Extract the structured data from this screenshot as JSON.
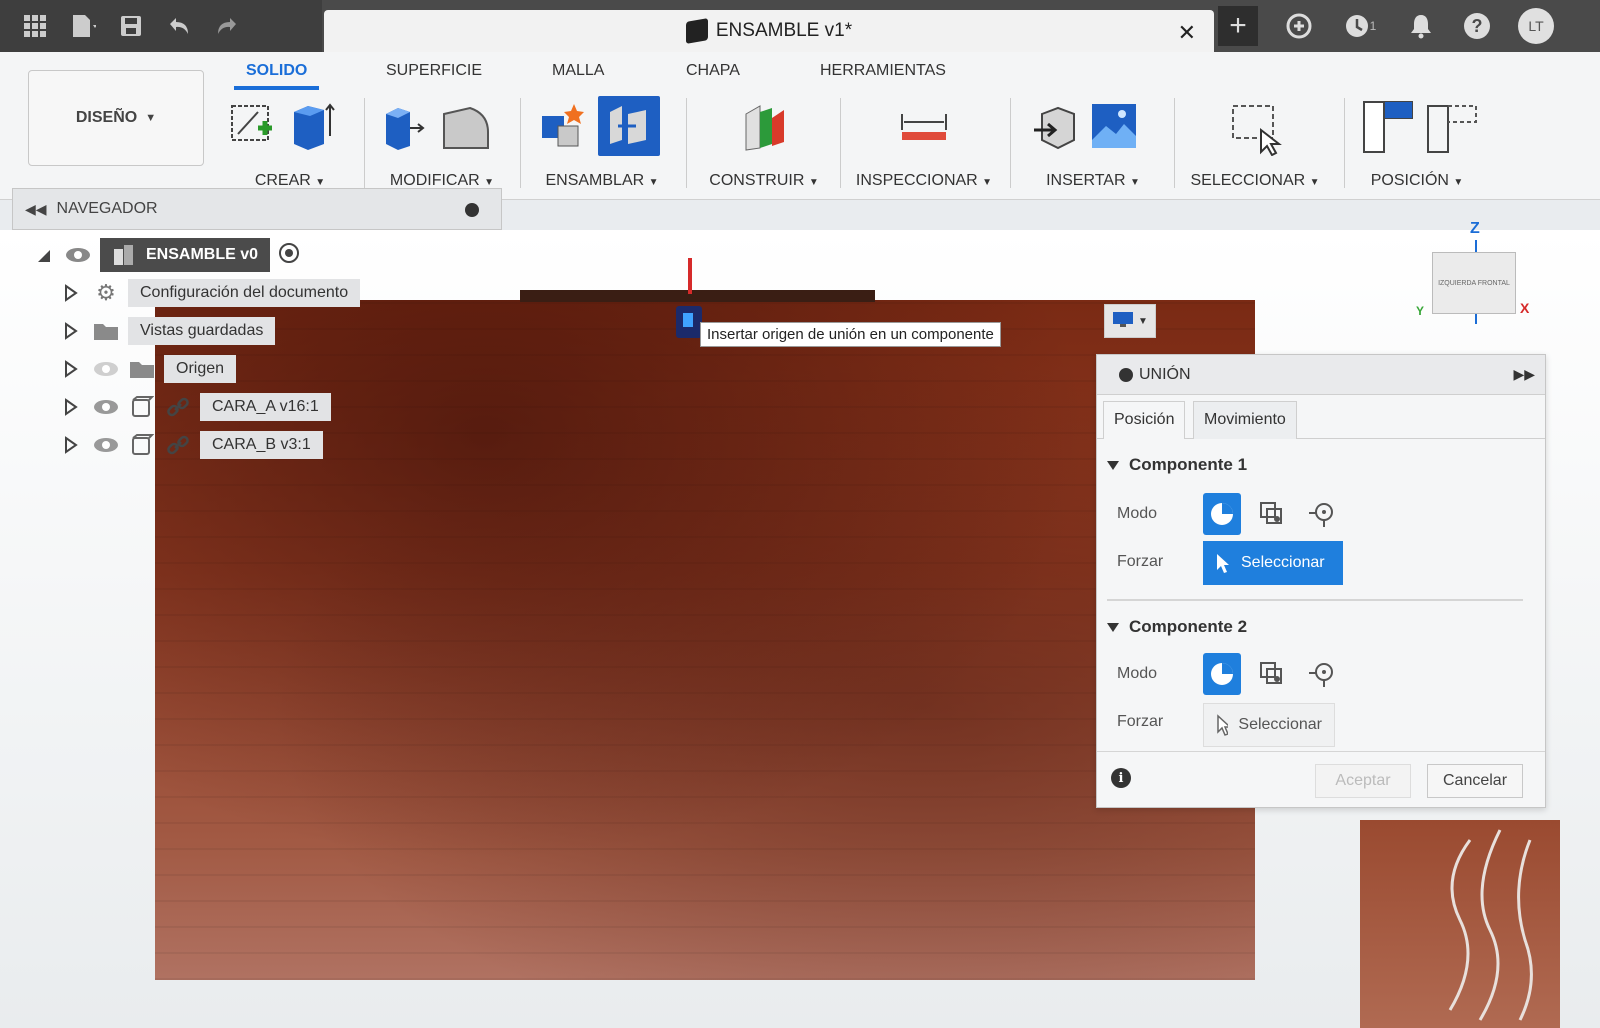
{
  "document": {
    "title": "ENSAMBLE v1*"
  },
  "topbar": {
    "avatar_initials": "LT",
    "job_count": "1"
  },
  "toolbar": {
    "workspace": "DISEÑO",
    "tabs": [
      "SOLIDO",
      "SUPERFICIE",
      "MALLA",
      "CHAPA",
      "HERRAMIENTAS"
    ],
    "active_tab": "SOLIDO",
    "groups": [
      "CREAR",
      "MODIFICAR",
      "ENSAMBLAR",
      "CONSTRUIR",
      "INSPECCIONAR",
      "INSERTAR",
      "SELECCIONAR",
      "POSICIÓN"
    ]
  },
  "navigator": {
    "title": "NAVEGADOR",
    "root": "ENSAMBLE v0",
    "items": [
      {
        "label": "Configuración del documento",
        "icon": "gear-icon"
      },
      {
        "label": "Vistas guardadas",
        "icon": "folder-icon"
      },
      {
        "label": "Origen",
        "icon": "folder-icon"
      },
      {
        "label": "CARA_A v16:1",
        "icon": "link-icon"
      },
      {
        "label": "CARA_B v3:1",
        "icon": "link-icon"
      }
    ]
  },
  "viewport": {
    "tooltip": "Insertar origen de unión en un componente"
  },
  "viewcube": {
    "z": "Z",
    "x": "X",
    "y": "Y",
    "faces": "IZQUIERDA  FRONTAL"
  },
  "joint_panel": {
    "title": "UNIÓN",
    "tabs": [
      "Posición",
      "Movimiento"
    ],
    "component1": {
      "title": "Componente 1",
      "mode_label": "Modo",
      "force_label": "Forzar",
      "select_label": "Seleccionar"
    },
    "component2": {
      "title": "Componente 2",
      "mode_label": "Modo",
      "force_label": "Forzar",
      "select_label": "Seleccionar"
    },
    "ok_label": "Aceptar",
    "cancel_label": "Cancelar"
  },
  "colors": {
    "accent": "#1f7fdd",
    "titlebar": "#4a4a4a",
    "wood": "#8f3a22"
  }
}
